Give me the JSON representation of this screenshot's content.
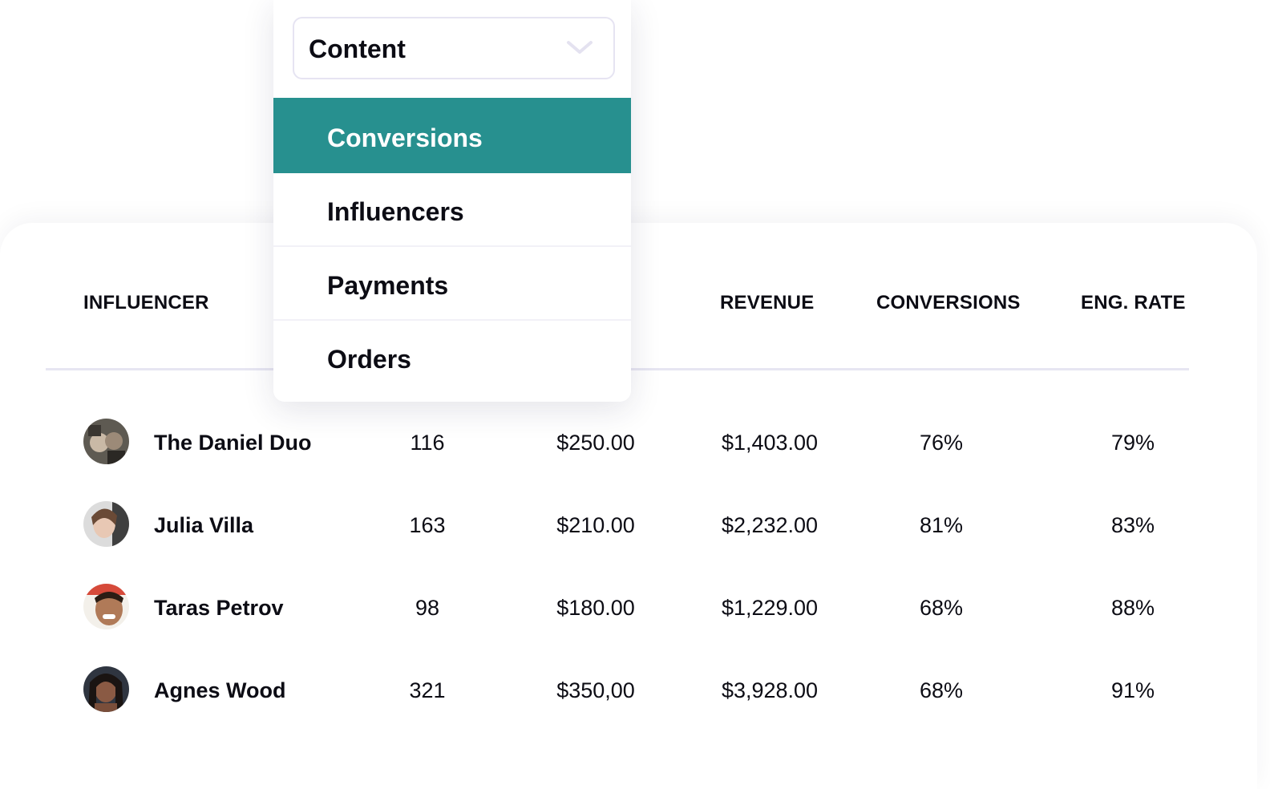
{
  "colors": {
    "accent": "#27908f",
    "divider": "#e7e6f2",
    "text": "#0c0c14",
    "selected_text": "#ffffff"
  },
  "dropdown": {
    "selected_value": "Content",
    "chevron_icon": "chevron-down-icon",
    "options": [
      {
        "label": "Conversions",
        "highlighted": true
      },
      {
        "label": "Influencers",
        "highlighted": false
      },
      {
        "label": "Payments",
        "highlighted": false
      },
      {
        "label": "Orders",
        "highlighted": false
      }
    ]
  },
  "table": {
    "columns": {
      "influencer": "INFLUENCER",
      "revenue": "REVENUE",
      "conversions": "CONVERSIONS",
      "eng_rate": "ENG. RATE"
    },
    "rows": [
      {
        "name": "The Daniel Duo",
        "col2": "116",
        "col3": "$250.00",
        "revenue": "$1,403.00",
        "conversions": "76%",
        "eng_rate": "79%",
        "avatar": "avatar-photo"
      },
      {
        "name": "Julia Villa",
        "col2": "163",
        "col3": "$210.00",
        "revenue": "$2,232.00",
        "conversions": "81%",
        "eng_rate": "83%",
        "avatar": "avatar-photo"
      },
      {
        "name": "Taras Petrov",
        "col2": "98",
        "col3": "$180.00",
        "revenue": "$1,229.00",
        "conversions": "68%",
        "eng_rate": "88%",
        "avatar": "avatar-photo"
      },
      {
        "name": "Agnes Wood",
        "col2": "321",
        "col3": "$350,00",
        "revenue": "$3,928.00",
        "conversions": "68%",
        "eng_rate": "91%",
        "avatar": "avatar-photo"
      }
    ]
  }
}
